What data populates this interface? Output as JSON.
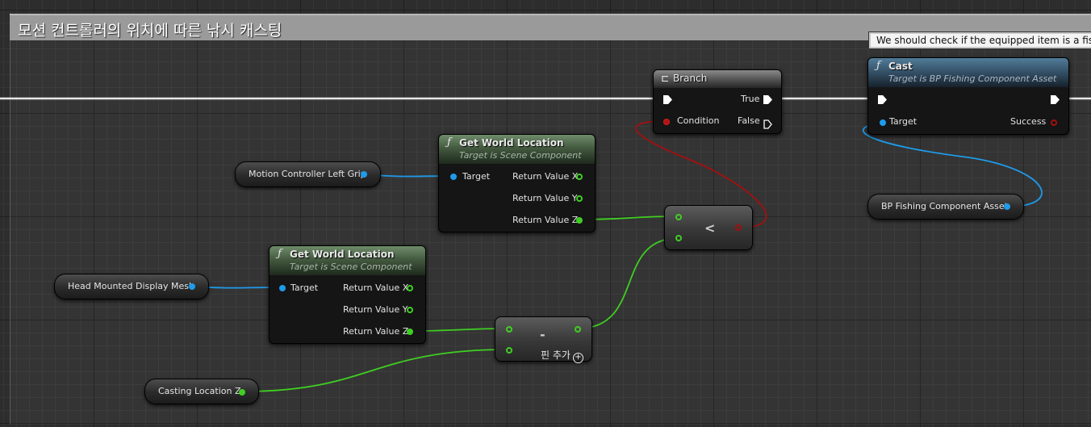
{
  "comment": {
    "title": "모션 컨트롤러의 위치에 따른 낚시 캐스팅",
    "tooltip": "We should check if the equipped item is a fishing r"
  },
  "nodes": {
    "branch": {
      "title": "Branch",
      "exec_out_true": "True",
      "exec_out_false": "False",
      "condition": "Condition"
    },
    "cast": {
      "title": "Cast",
      "subtitle": "Target is BP Fishing Component Asset",
      "target": "Target",
      "success": "Success"
    },
    "get_world_location_1": {
      "title": "Get World Location",
      "subtitle": "Target is Scene Component",
      "target": "Target",
      "x": "Return Value X",
      "y": "Return Value Y",
      "z": "Return Value Z"
    },
    "get_world_location_2": {
      "title": "Get World Location",
      "subtitle": "Target is Scene Component",
      "target": "Target",
      "x": "Return Value X",
      "y": "Return Value Y",
      "z": "Return Value Z"
    },
    "less_than": {
      "symbol": "<"
    },
    "subtract": {
      "symbol": "-",
      "add_pin": "핀 추가"
    }
  },
  "variables": {
    "motion_controller": "Motion Controller Left Grip",
    "head_mounted": "Head Mounted Display Mesh",
    "casting_location": "Casting Location Z",
    "bp_fishing": "BP Fishing Component Asset"
  },
  "colors": {
    "exec_wire": "#ffffff",
    "object_wire": "#1e9bea",
    "float_wire": "#3fcf22",
    "bool_wire": "#a31010"
  }
}
